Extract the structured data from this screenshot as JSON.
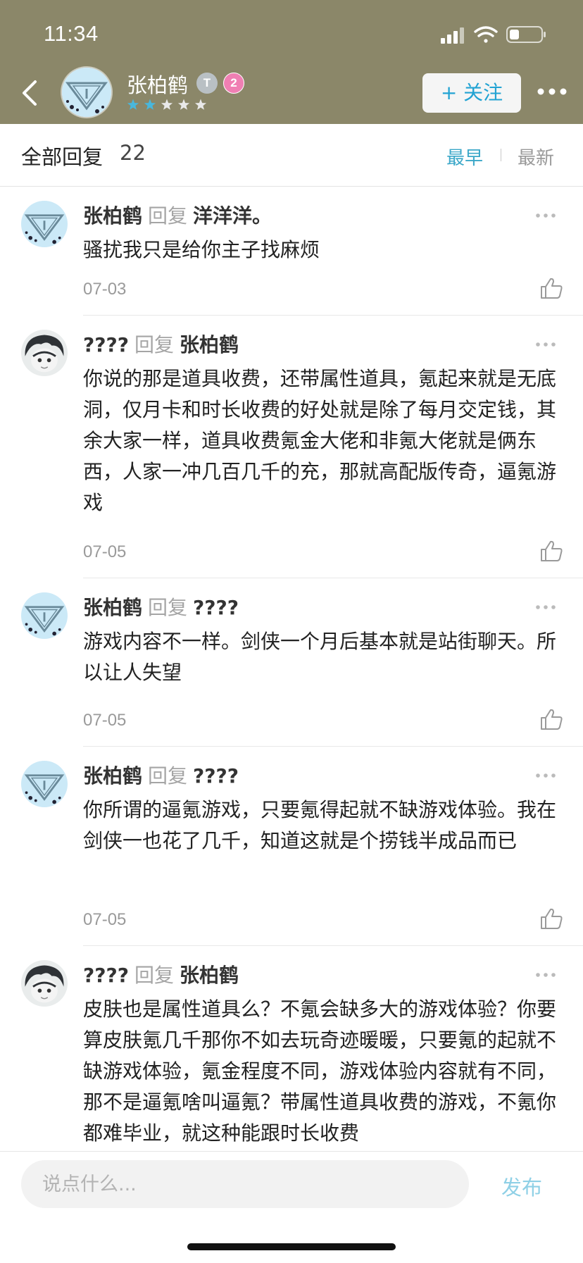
{
  "status_bar": {
    "time": "11:34",
    "icons": [
      "signal-icon",
      "wifi-icon",
      "battery-icon"
    ]
  },
  "header": {
    "username": "张柏鹤",
    "level_badge": "T",
    "num_badge": "2",
    "rating_stars_filled": 2,
    "rating_stars_total": 5,
    "follow_label": "+ 关注",
    "bg_color": "#8b8769"
  },
  "sort_bar": {
    "title": "全部回复",
    "count": "22",
    "earliest_label": "最早",
    "latest_label": "最新",
    "active": "earliest"
  },
  "comments": [
    {
      "author": "张柏鹤",
      "reply_label": "回复",
      "target": "洋洋洋。",
      "body": "骚扰我只是给你主子找麻烦",
      "date": "07-03",
      "avatar": "diamond-avatar"
    },
    {
      "author": "????",
      "reply_label": "回复",
      "target": "张柏鹤",
      "body": "你说的那是道具收费，还带属性道具，氪起来就是无底洞，仅月卡和时长收费的好处就是除了每月交定钱，其余大家一样，道具收费氪金大佬和非氪大佬就是俩东西，人家一冲几百几千的充，那就高配版传奇，逼氪游戏",
      "date": "07-05",
      "avatar": "anime-avatar"
    },
    {
      "author": "张柏鹤",
      "reply_label": "回复",
      "target": "????",
      "body": "游戏内容不一样。剑侠一个月后基本就是站街聊天。所以让人失望",
      "date": "07-05",
      "avatar": "diamond-avatar"
    },
    {
      "author": "张柏鹤",
      "reply_label": "回复",
      "target": "????",
      "body": "你所谓的逼氪游戏，只要氪得起就不缺游戏体验。我在剑侠一也花了几千，知道这就是个捞钱半成品而已",
      "date": "07-05",
      "avatar": "diamond-avatar"
    },
    {
      "author": "????",
      "reply_label": "回复",
      "target": "张柏鹤",
      "body": "皮肤也是属性道具么？不氪会缺多大的游戏体验？你要算皮肤氪几千那你不如去玩奇迹暖暖，只要氪的起就不缺游戏体验，氪金程度不同，游戏体验内容就有不同，那不是逼氪啥叫逼氪？带属性道具收费的游戏，不氪你都难毕业，就这种能跟时长收费",
      "date": "",
      "avatar": "anime-avatar"
    }
  ],
  "reply_box": {
    "placeholder": "说点什么...",
    "publish_label": "发布"
  },
  "colors": {
    "accent": "#3aa7c8",
    "publish": "#8fd0e6",
    "follow_text": "#22a3d3",
    "muted": "#9a9a9a"
  }
}
